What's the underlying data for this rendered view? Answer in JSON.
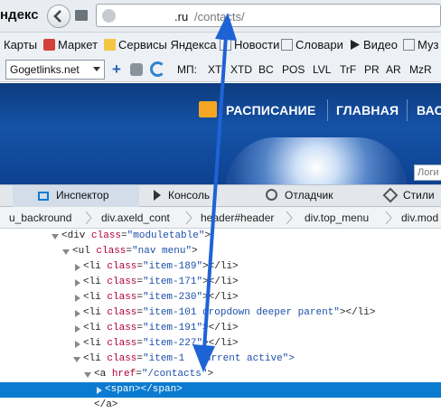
{
  "browser": {
    "brand": "ндекс",
    "url": {
      "host": ".ru",
      "path": "/contacts/"
    }
  },
  "bookmarks": [
    {
      "label": "Карты",
      "icon": "yandex-maps-icon"
    },
    {
      "label": "Маркет",
      "icon": "yandex-market-icon"
    },
    {
      "label": "Сервисы Яндекса",
      "icon": "folder-icon"
    },
    {
      "label": "Новости",
      "icon": "news-icon"
    },
    {
      "label": "Словари",
      "icon": "dictionary-icon"
    },
    {
      "label": "Видео",
      "icon": "video-icon"
    },
    {
      "label": "Муз",
      "icon": "music-icon"
    }
  ],
  "extension": {
    "dropdown": "Gogetlinks.net",
    "label": "МП:",
    "items": [
      "XT",
      "XTD",
      "BC",
      "POS",
      "LVL",
      "TrF",
      "PR",
      "AR",
      "MzR"
    ]
  },
  "page": {
    "menu": [
      "РАСПИСАНИЕ",
      "ГЛАВНАЯ",
      "ВАС"
    ],
    "login_placeholder": "Логи"
  },
  "devtools": {
    "tabs": [
      "Инспектор",
      "Консоль",
      "Отладчик",
      "Стили"
    ],
    "breadcrumbs": [
      "u_backround",
      "div.axeld_cont",
      "header#header",
      "div.top_menu",
      "div.mod"
    ],
    "tree": [
      {
        "open": "<div ",
        "attr": "class",
        "val": "\"moduletable\"",
        "close": ">"
      },
      {
        "open": "<ul ",
        "attr": "class",
        "val": "\"nav menu\"",
        "close": ">"
      },
      {
        "open": "<li ",
        "attr": "class",
        "val": "\"item-189\"",
        "close": "></li>"
      },
      {
        "open": "<li ",
        "attr": "class",
        "val": "\"item-171\"",
        "close": "></li>"
      },
      {
        "open": "<li ",
        "attr": "class",
        "val": "\"item-230\"",
        "close": "></li>"
      },
      {
        "open": "<li ",
        "attr": "class",
        "val": "\"item-101 dropdown deeper parent\"",
        "close": "></li>"
      },
      {
        "open": "<li ",
        "attr": "class",
        "val": "\"item-191\"",
        "close": "></li>"
      },
      {
        "open": "<li ",
        "attr": "class",
        "val": "\"item-227\"",
        "close": "></li>"
      },
      {
        "open": "<li ",
        "attr": "class",
        "val": "\"item-1",
        "close": "current active\">"
      },
      {
        "open": "<a ",
        "attr": "href",
        "val": "\"/contacts\"",
        "close": ">"
      },
      {
        "open": "<span></span>",
        "attr": "",
        "val": "",
        "close": ""
      },
      {
        "open": "</a>",
        "attr": "",
        "val": "",
        "close": ""
      }
    ]
  },
  "colors": {
    "selection": "#0b7bd1",
    "arrow": "#1e63d6",
    "banner": "#1553a8",
    "accent": "#f5a623"
  }
}
